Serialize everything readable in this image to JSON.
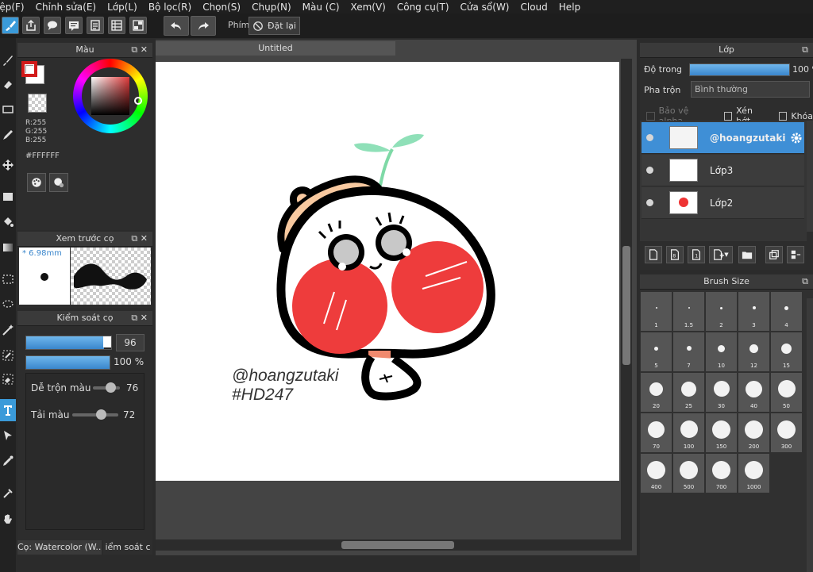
{
  "menu": [
    "Tệp(F)",
    "Chỉnh sửa(E)",
    "Lớp(L)",
    "Bộ lọc(R)",
    "Chọn(S)",
    "Chụp(N)",
    "Màu (C)",
    "Xem(V)",
    "Công cụ(T)",
    "Cửa sổ(W)",
    "Cloud",
    "Help"
  ],
  "toolbar": {
    "phim_label": "Phím",
    "reset_label": "Đặt lại"
  },
  "color_panel": {
    "title": "Màu",
    "r": "R:255",
    "g": "G:255",
    "b": "B:255",
    "hex": "#FFFFFF",
    "primary_color": "#d11a1a"
  },
  "canvas": {
    "tab_title": "Untitled",
    "watermark_line1": "@hoangzutaki",
    "watermark_line2": "#HD247"
  },
  "brush_preview": {
    "title": "Xem trước cọ",
    "size": "* 6.98mm"
  },
  "brush_control": {
    "title": "Kiểm soát cọ",
    "size_value": "96",
    "size_fraction": 0.92,
    "opacity_value": "100 %",
    "opacity_fraction": 1.0,
    "blend_label": "Dễ trộn màu",
    "blend_value": "76",
    "reload_label": "Tải màu",
    "reload_value": "72"
  },
  "bottom_tabs": [
    "Cọ: Watercolor (W...",
    "iểm soát c"
  ],
  "layers_panel": {
    "title": "Lớp",
    "opacity_label": "Độ trong",
    "opacity_value": "100 %",
    "blend_label": "Pha trộn",
    "blend_value": "Bình thường",
    "protect_alpha": "Bảo vệ alpha",
    "clipping": "Xén bớt",
    "lock": "Khóa",
    "layers": [
      {
        "name": "@hoangzutaki",
        "selected": true
      },
      {
        "name": "Lớp3",
        "selected": false
      },
      {
        "name": "Lớp2",
        "selected": false
      }
    ]
  },
  "brush_size": {
    "title": "Brush Size",
    "sizes": [
      "1",
      "1.5",
      "2",
      "3",
      "4",
      "5",
      "7",
      "10",
      "12",
      "15",
      "20",
      "25",
      "30",
      "40",
      "50",
      "70",
      "100",
      "150",
      "200",
      "300",
      "400",
      "500",
      "700",
      "1000"
    ]
  }
}
